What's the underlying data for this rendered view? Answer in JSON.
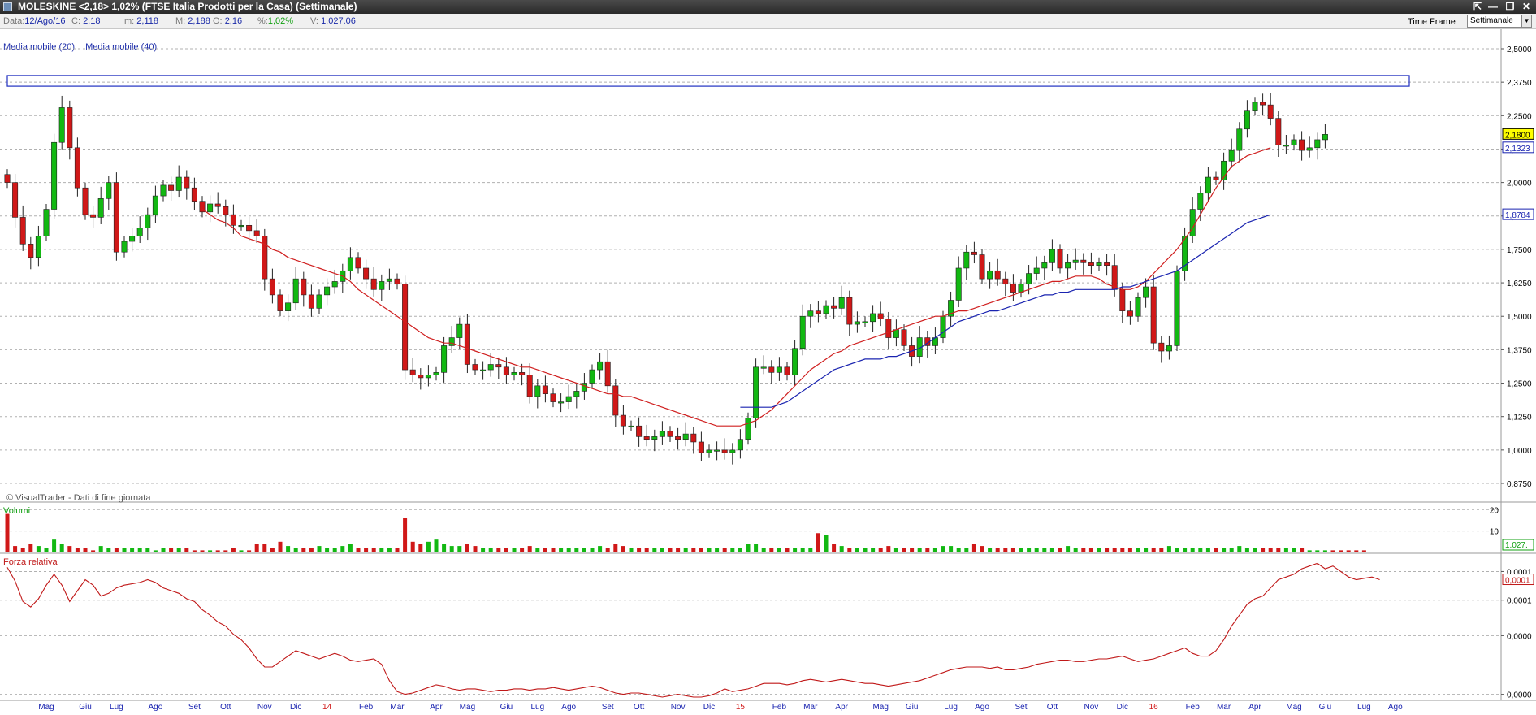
{
  "window": {
    "title": "MOLESKINE <2,18> 1,02%  (FTSE Italia Prodotti per la Casa)  (Settimanale)",
    "buttons": [
      "⇱",
      "—",
      "❐",
      "✕"
    ]
  },
  "infobar": {
    "date_label": "Data:",
    "date_value": "12/Ago/16",
    "close_label": "C:",
    "close_value": "2,18",
    "min_label": "m:",
    "min_value": "2,118",
    "max_label": "M:",
    "max_value": "2,188",
    "open_label": "O:",
    "open_value": "2,16",
    "pct_label": "%:",
    "pct_value": "1,02%",
    "vol_label": "V:",
    "vol_value": "1.027.06",
    "timeframe_label": "Time Frame",
    "timeframe_value": "Settimanale"
  },
  "legend": {
    "ma20": "Media mobile (20)",
    "ma40": "Media mobile (40)"
  },
  "colors": {
    "up": "#12b812",
    "down": "#d01818",
    "ma20": "#d02020",
    "ma40": "#1a24b0",
    "grid": "#b0b0b0",
    "rs": "#c01818"
  },
  "chart_data": {
    "type": "candlestick",
    "price_axis": {
      "ticks": [
        "2,5000",
        "2,3750",
        "2,2500",
        "2,1250",
        "2,0000",
        "1,8750",
        "1,7500",
        "1,6250",
        "1,5000",
        "1,3750",
        "1,2500",
        "1,1250",
        "1,0000",
        "0,8750"
      ],
      "tick_values": [
        2.5,
        2.375,
        2.25,
        2.125,
        2.0,
        1.875,
        1.75,
        1.625,
        1.5,
        1.375,
        1.25,
        1.125,
        1.0,
        0.875
      ],
      "ylim": [
        0.875,
        2.5
      ],
      "last_price_label": "2,1800",
      "ma20_label": "2,1323",
      "ma40_label": "1,8784"
    },
    "resistance_zone": [
      2.36,
      2.4
    ],
    "x_labels": [
      {
        "label": "Mag",
        "i": 5
      },
      {
        "label": "Giu",
        "i": 10
      },
      {
        "label": "Lug",
        "i": 14
      },
      {
        "label": "Ago",
        "i": 19
      },
      {
        "label": "Set",
        "i": 24
      },
      {
        "label": "Ott",
        "i": 28
      },
      {
        "label": "Nov",
        "i": 33
      },
      {
        "label": "Dic",
        "i": 37
      },
      {
        "label": "14",
        "i": 41,
        "red": true
      },
      {
        "label": "Feb",
        "i": 46
      },
      {
        "label": "Mar",
        "i": 50
      },
      {
        "label": "Apr",
        "i": 55
      },
      {
        "label": "Mag",
        "i": 59
      },
      {
        "label": "Giu",
        "i": 64
      },
      {
        "label": "Lug",
        "i": 68
      },
      {
        "label": "Ago",
        "i": 72
      },
      {
        "label": "Set",
        "i": 77
      },
      {
        "label": "Ott",
        "i": 81
      },
      {
        "label": "Nov",
        "i": 86
      },
      {
        "label": "Dic",
        "i": 90
      },
      {
        "label": "15",
        "i": 94,
        "red": true
      },
      {
        "label": "Feb",
        "i": 99
      },
      {
        "label": "Mar",
        "i": 103
      },
      {
        "label": "Apr",
        "i": 107
      },
      {
        "label": "Mag",
        "i": 112
      },
      {
        "label": "Giu",
        "i": 116
      },
      {
        "label": "Lug",
        "i": 121
      },
      {
        "label": "Ago",
        "i": 125
      },
      {
        "label": "Set",
        "i": 130
      },
      {
        "label": "Ott",
        "i": 134
      },
      {
        "label": "Nov",
        "i": 139
      },
      {
        "label": "Dic",
        "i": 143
      },
      {
        "label": "16",
        "i": 147,
        "red": true
      },
      {
        "label": "Feb",
        "i": 152
      },
      {
        "label": "Mar",
        "i": 156
      },
      {
        "label": "Apr",
        "i": 160
      },
      {
        "label": "Mag",
        "i": 165
      },
      {
        "label": "Giu",
        "i": 169
      },
      {
        "label": "Lug",
        "i": 174
      },
      {
        "label": "Ago",
        "i": 178
      }
    ],
    "closes": [
      2.0,
      1.87,
      1.77,
      1.72,
      1.8,
      1.9,
      2.15,
      2.28,
      2.13,
      1.98,
      1.88,
      1.87,
      1.94,
      2.0,
      1.74,
      1.78,
      1.8,
      1.83,
      1.88,
      1.95,
      1.99,
      1.97,
      2.02,
      1.98,
      1.93,
      1.89,
      1.92,
      1.91,
      1.88,
      1.84,
      1.84,
      1.82,
      1.8,
      1.64,
      1.58,
      1.52,
      1.55,
      1.64,
      1.58,
      1.53,
      1.58,
      1.61,
      1.63,
      1.67,
      1.72,
      1.68,
      1.64,
      1.6,
      1.63,
      1.64,
      1.62,
      1.3,
      1.28,
      1.27,
      1.28,
      1.29,
      1.39,
      1.42,
      1.47,
      1.32,
      1.3,
      1.3,
      1.32,
      1.31,
      1.28,
      1.29,
      1.28,
      1.2,
      1.24,
      1.21,
      1.18,
      1.18,
      1.2,
      1.22,
      1.25,
      1.3,
      1.33,
      1.24,
      1.13,
      1.09,
      1.09,
      1.05,
      1.04,
      1.05,
      1.07,
      1.05,
      1.04,
      1.06,
      1.03,
      0.99,
      1.0,
      1.0,
      0.99,
      1.0,
      1.04,
      1.12,
      1.31,
      1.31,
      1.29,
      1.31,
      1.28,
      1.38,
      1.5,
      1.52,
      1.51,
      1.54,
      1.53,
      1.57,
      1.47,
      1.48,
      1.48,
      1.51,
      1.49,
      1.42,
      1.45,
      1.39,
      1.35,
      1.42,
      1.39,
      1.42,
      1.5,
      1.56,
      1.68,
      1.74,
      1.73,
      1.64,
      1.67,
      1.64,
      1.62,
      1.59,
      1.62,
      1.66,
      1.68,
      1.7,
      1.75,
      1.68,
      1.7,
      1.71,
      1.7,
      1.69,
      1.7,
      1.69,
      1.6,
      1.52,
      1.5,
      1.57,
      1.61,
      1.4,
      1.37,
      1.39,
      1.67,
      1.8,
      1.9,
      1.96,
      2.02,
      2.01,
      2.08,
      2.12,
      2.2,
      2.27,
      2.3,
      2.29,
      2.24,
      2.14,
      2.14,
      2.16,
      2.12,
      2.13,
      2.16,
      2.18
    ],
    "ma20": [
      null,
      null,
      null,
      null,
      null,
      null,
      null,
      null,
      null,
      null,
      null,
      null,
      null,
      null,
      null,
      null,
      null,
      null,
      null,
      null,
      null,
      null,
      null,
      null,
      null,
      1.9,
      1.88,
      1.86,
      1.85,
      1.83,
      1.8,
      1.79,
      1.78,
      1.77,
      1.75,
      1.74,
      1.72,
      1.71,
      1.7,
      1.69,
      1.68,
      1.67,
      1.66,
      1.65,
      1.63,
      1.6,
      1.58,
      1.56,
      1.54,
      1.52,
      1.5,
      1.48,
      1.46,
      1.44,
      1.42,
      1.41,
      1.4,
      1.4,
      1.39,
      1.38,
      1.37,
      1.36,
      1.35,
      1.34,
      1.33,
      1.32,
      1.31,
      1.31,
      1.3,
      1.29,
      1.28,
      1.27,
      1.26,
      1.25,
      1.24,
      1.23,
      1.22,
      1.21,
      1.21,
      1.2,
      1.2,
      1.19,
      1.18,
      1.17,
      1.16,
      1.15,
      1.14,
      1.13,
      1.12,
      1.11,
      1.1,
      1.09,
      1.09,
      1.09,
      1.09,
      1.1,
      1.11,
      1.13,
      1.15,
      1.18,
      1.21,
      1.24,
      1.27,
      1.3,
      1.32,
      1.34,
      1.36,
      1.37,
      1.39,
      1.4,
      1.41,
      1.42,
      1.43,
      1.44,
      1.45,
      1.46,
      1.47,
      1.48,
      1.49,
      1.5,
      1.5,
      1.51,
      1.52,
      1.52,
      1.53,
      1.54,
      1.55,
      1.56,
      1.57,
      1.58,
      1.59,
      1.6,
      1.61,
      1.62,
      1.63,
      1.63,
      1.64,
      1.65,
      1.65,
      1.65,
      1.64,
      1.62,
      1.61,
      1.6,
      1.6,
      1.61,
      1.63,
      1.66,
      1.69,
      1.72,
      1.75,
      1.79,
      1.83,
      1.88,
      1.93,
      1.98,
      2.02,
      2.06,
      2.08,
      2.1,
      2.11,
      2.12,
      2.13
    ],
    "ma40": [
      null,
      null,
      null,
      null,
      null,
      null,
      null,
      null,
      null,
      null,
      null,
      null,
      null,
      null,
      null,
      null,
      null,
      null,
      null,
      null,
      null,
      null,
      null,
      null,
      null,
      null,
      null,
      null,
      null,
      null,
      null,
      null,
      null,
      null,
      null,
      null,
      null,
      null,
      null,
      null,
      null,
      null,
      null,
      null,
      null,
      null,
      null,
      null,
      null,
      null,
      null,
      null,
      null,
      null,
      null,
      null,
      null,
      null,
      null,
      null,
      null,
      null,
      null,
      null,
      null,
      null,
      null,
      null,
      null,
      null,
      null,
      null,
      null,
      null,
      null,
      null,
      null,
      null,
      null,
      null,
      null,
      null,
      null,
      null,
      null,
      null,
      null,
      null,
      null,
      null,
      null,
      null,
      null,
      null,
      1.16,
      1.16,
      1.16,
      1.16,
      1.16,
      1.17,
      1.18,
      1.2,
      1.22,
      1.24,
      1.26,
      1.28,
      1.3,
      1.31,
      1.32,
      1.33,
      1.34,
      1.34,
      1.34,
      1.35,
      1.35,
      1.36,
      1.37,
      1.38,
      1.4,
      1.42,
      1.44,
      1.46,
      1.48,
      1.49,
      1.5,
      1.51,
      1.52,
      1.52,
      1.53,
      1.54,
      1.55,
      1.56,
      1.57,
      1.58,
      1.58,
      1.59,
      1.59,
      1.6,
      1.6,
      1.6,
      1.6,
      1.6,
      1.6,
      1.61,
      1.61,
      1.62,
      1.63,
      1.64,
      1.65,
      1.66,
      1.67,
      1.69,
      1.71,
      1.73,
      1.75,
      1.77,
      1.79,
      1.81,
      1.83,
      1.85,
      1.86,
      1.87,
      1.88
    ],
    "volume": {
      "ticks": [
        "20",
        "10"
      ],
      "tick_values": [
        20,
        10
      ],
      "ylim": [
        0,
        22
      ],
      "last_label": "1.027.",
      "panel_title": "Volumi",
      "values": [
        18,
        3,
        2,
        4,
        3,
        2,
        6,
        4,
        3,
        2,
        2,
        1,
        3,
        2,
        2,
        2,
        2,
        2,
        2,
        1,
        2,
        2,
        2,
        2,
        1,
        1,
        1,
        1,
        1,
        2,
        1,
        1,
        4,
        4,
        2,
        5,
        3,
        2,
        2,
        2,
        3,
        2,
        2,
        3,
        4,
        2,
        2,
        2,
        2,
        2,
        2,
        16,
        5,
        4,
        5,
        6,
        4,
        3,
        3,
        4,
        3,
        2,
        2,
        2,
        2,
        2,
        2,
        3,
        2,
        2,
        2,
        2,
        2,
        2,
        2,
        2,
        3,
        2,
        4,
        3,
        2,
        2,
        2,
        2,
        2,
        2,
        2,
        2,
        2,
        2,
        2,
        2,
        2,
        2,
        2,
        4,
        4,
        2,
        2,
        2,
        2,
        2,
        2,
        2,
        9,
        8,
        4,
        3,
        2,
        2,
        2,
        2,
        2,
        3,
        2,
        2,
        2,
        2,
        2,
        2,
        3,
        3,
        2,
        2,
        4,
        3,
        2,
        2,
        2,
        2,
        2,
        2,
        2,
        2,
        2,
        2,
        3,
        2,
        2,
        2,
        2,
        2,
        2,
        2,
        2,
        2,
        2,
        2,
        2,
        3,
        2,
        2,
        2,
        2,
        2,
        2,
        2,
        2,
        3,
        2,
        2,
        2,
        2,
        2,
        2,
        2,
        2,
        1,
        1,
        1,
        1,
        1,
        1,
        1,
        1
      ]
    },
    "rs": {
      "panel_title": "Forza relativa",
      "ticks": [
        "0,0001",
        "0,0001",
        "0,0000",
        "0,0000"
      ],
      "last_label": "0,0001",
      "values": [
        0.95,
        0.85,
        0.7,
        0.66,
        0.72,
        0.82,
        0.9,
        0.82,
        0.7,
        0.78,
        0.86,
        0.82,
        0.74,
        0.76,
        0.8,
        0.82,
        0.83,
        0.84,
        0.86,
        0.84,
        0.8,
        0.78,
        0.76,
        0.72,
        0.7,
        0.64,
        0.6,
        0.55,
        0.52,
        0.46,
        0.42,
        0.36,
        0.28,
        0.22,
        0.22,
        0.26,
        0.3,
        0.34,
        0.32,
        0.3,
        0.28,
        0.3,
        0.32,
        0.3,
        0.27,
        0.26,
        0.27,
        0.28,
        0.24,
        0.12,
        0.04,
        0.02,
        0.03,
        0.05,
        0.07,
        0.09,
        0.08,
        0.06,
        0.05,
        0.06,
        0.06,
        0.05,
        0.04,
        0.05,
        0.05,
        0.06,
        0.06,
        0.05,
        0.06,
        0.06,
        0.07,
        0.06,
        0.05,
        0.06,
        0.07,
        0.08,
        0.07,
        0.05,
        0.03,
        0.02,
        0.03,
        0.03,
        0.02,
        0.01,
        0.0,
        0.01,
        0.02,
        0.01,
        0.0,
        0.0,
        0.01,
        0.03,
        0.06,
        0.04,
        0.05,
        0.06,
        0.08,
        0.1,
        0.1,
        0.1,
        0.09,
        0.1,
        0.12,
        0.13,
        0.12,
        0.11,
        0.12,
        0.13,
        0.12,
        0.11,
        0.1,
        0.1,
        0.09,
        0.08,
        0.09,
        0.1,
        0.11,
        0.12,
        0.14,
        0.16,
        0.18,
        0.2,
        0.21,
        0.22,
        0.22,
        0.22,
        0.21,
        0.22,
        0.2,
        0.2,
        0.21,
        0.22,
        0.24,
        0.25,
        0.26,
        0.27,
        0.27,
        0.26,
        0.26,
        0.27,
        0.28,
        0.28,
        0.29,
        0.3,
        0.28,
        0.26,
        0.27,
        0.28,
        0.3,
        0.32,
        0.34,
        0.36,
        0.32,
        0.3,
        0.3,
        0.34,
        0.42,
        0.52,
        0.6,
        0.68,
        0.72,
        0.74,
        0.8,
        0.86,
        0.88,
        0.9,
        0.94,
        0.96,
        0.98,
        0.94,
        0.96,
        0.92,
        0.88,
        0.86,
        0.87,
        0.88,
        0.86
      ]
    }
  },
  "footer_note": "© VisualTrader - Dati di fine giornata"
}
